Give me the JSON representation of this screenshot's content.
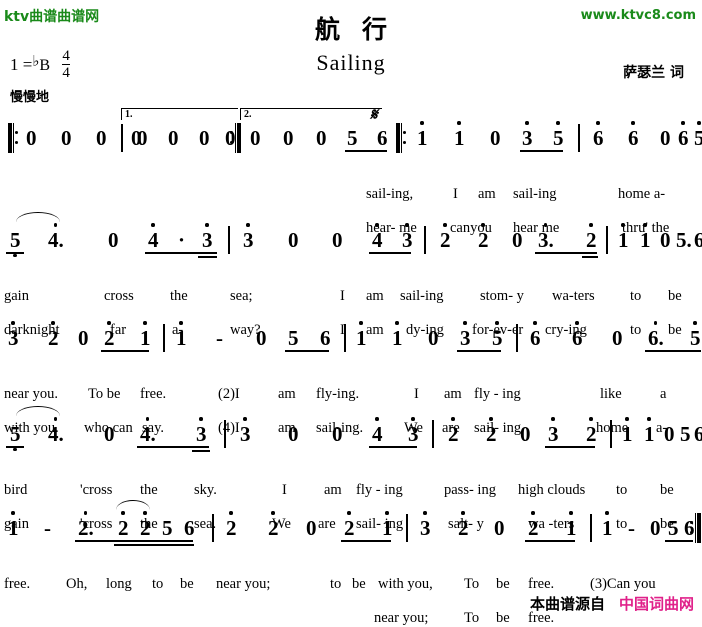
{
  "header": {
    "logo": "ktv曲谱曲谱网",
    "url": "www.ktvc8.com",
    "title_cn": "航行",
    "title_en": "Sailing",
    "credit": "萨瑟兰 词",
    "key_prefix": "1 =",
    "key_accidental": "♭",
    "key_note": "B",
    "meter_num": "4",
    "meter_den": "4",
    "tempo": "慢慢地"
  },
  "footer": {
    "source_label": "本曲谱源自",
    "site_name": "中国词曲网"
  },
  "music": {
    "volta1_label": "1.",
    "volta2_label": "2.",
    "segno": "𝄋",
    "lines": [
      {
        "id": "line-1",
        "notes": [
          "0",
          "0",
          "0",
          "0",
          "0",
          "0",
          "0",
          "0",
          "0",
          "0",
          "0",
          "5",
          "6",
          "1",
          "1",
          "0",
          "3",
          "5",
          "6",
          "6",
          "0",
          "6",
          "5"
        ],
        "lyrics_v1": [
          "sail-ing,",
          "I",
          "am",
          "sail-ing",
          "home a-"
        ],
        "lyrics_v2": [
          "hear- me",
          "canyou",
          "hear me",
          "thru' the"
        ]
      },
      {
        "id": "line-2",
        "notes": [
          "5",
          "4.",
          "0",
          "4",
          "·",
          "3",
          "3",
          "0",
          "0",
          "4",
          "3",
          "2",
          "2",
          "0",
          "3.",
          "2",
          "1",
          "1",
          "0",
          "5.",
          "6"
        ],
        "lyrics_v1": [
          "gain",
          "cross",
          "the",
          "sea;",
          "I",
          "am",
          "sail-ing",
          "stom- y",
          "wa-ters",
          "to",
          "be"
        ],
        "lyrics_v2": [
          "darknight",
          "far",
          "a-",
          "way?",
          "I",
          "am",
          "dy-ing",
          "for-ev-er",
          "cry-ing",
          "to",
          "be"
        ]
      },
      {
        "id": "line-3",
        "notes": [
          "3",
          "2",
          "0",
          "2",
          "1",
          "1",
          "-",
          "0",
          "5",
          "6",
          "1",
          "1",
          "0",
          "3",
          "5",
          "6",
          "6",
          "0",
          "6.",
          "5"
        ],
        "lyrics_v1": [
          "near you.",
          "To be",
          "free.",
          "(2)I",
          "am",
          "fly-ing.",
          "I",
          "am",
          "fly - ing",
          "like",
          "a"
        ],
        "lyrics_v2": [
          "with you.",
          "who can",
          "say.",
          "(4)I",
          "am",
          "sail-ing.",
          "We",
          "are",
          "sail- ing",
          "home",
          "a-"
        ]
      },
      {
        "id": "line-4",
        "notes": [
          "5",
          "4.",
          "0",
          "4.",
          "3",
          "3",
          "0",
          "0",
          "4",
          "3",
          "2",
          "2",
          "0",
          "3",
          "2",
          "1",
          "1",
          "0",
          "5",
          "6"
        ],
        "lyrics_v1": [
          "bird",
          "'cross",
          "the",
          "sky.",
          "I",
          "am",
          "fly - ing",
          "pass- ing",
          "high clouds",
          "to",
          "be"
        ],
        "lyrics_v2": [
          "gain",
          "'cross",
          "the",
          "sea.",
          "We",
          "are",
          "sail- ing",
          "salt- y",
          "wa -ters",
          "to",
          "be"
        ]
      },
      {
        "id": "line-5",
        "notes": [
          "1",
          "-",
          "2.",
          "2",
          "2",
          "5",
          "6",
          "2",
          "2",
          "0",
          "2",
          "1",
          "3",
          "2",
          "0",
          "2",
          "1",
          "1",
          "-",
          "0",
          "5",
          "6"
        ],
        "lyrics_v1": [
          "free.",
          "Oh,",
          "long",
          "to",
          "be",
          "near you;",
          "to",
          "be",
          "with you,",
          "To",
          "be",
          "free.",
          "(3)Can you"
        ],
        "lyrics_v2": [
          "near you;",
          "To",
          "be",
          "free."
        ]
      }
    ]
  }
}
